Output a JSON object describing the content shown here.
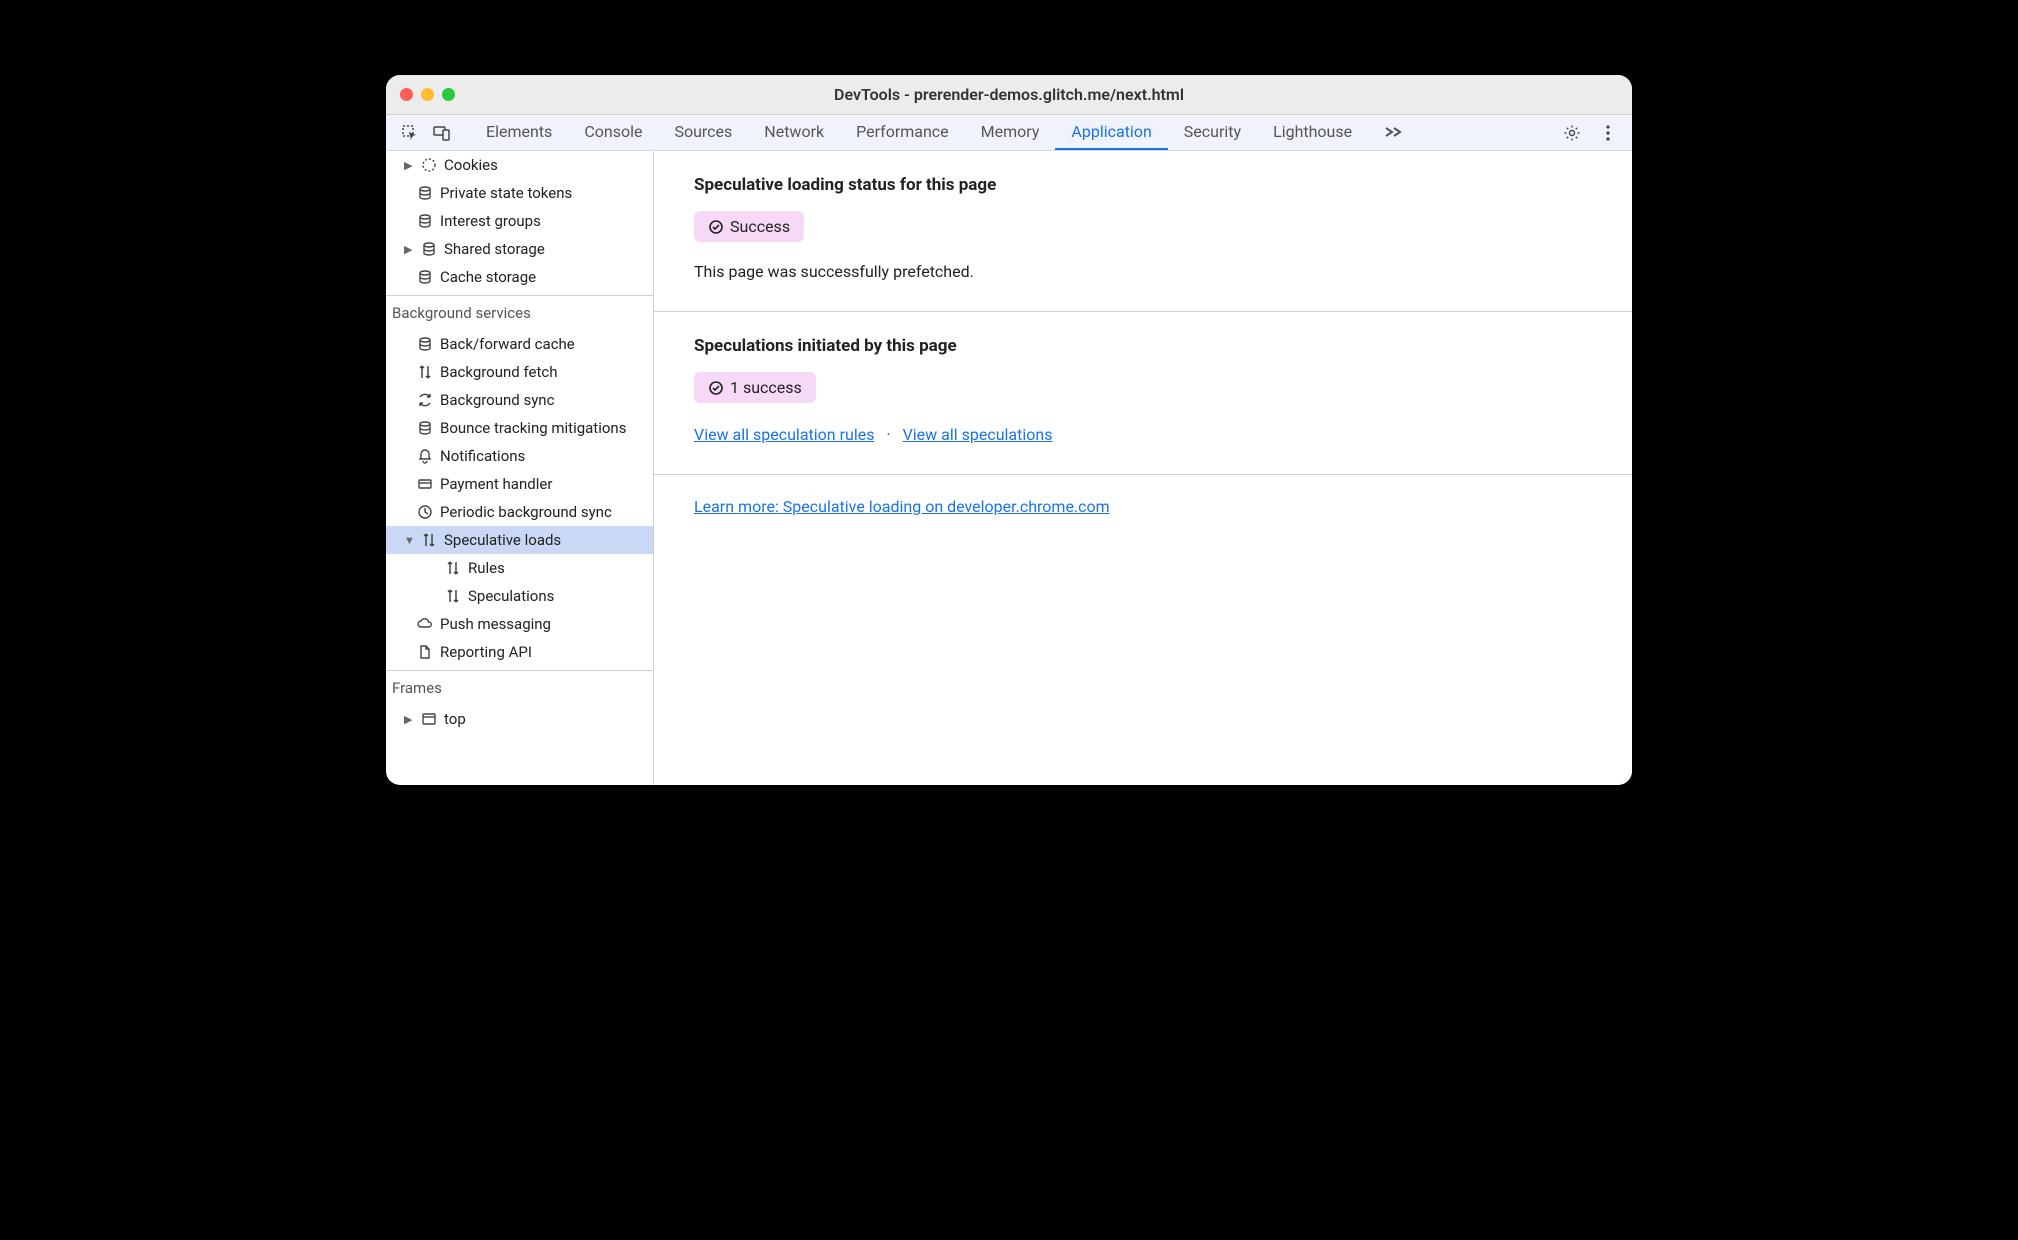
{
  "window": {
    "title": "DevTools - prerender-demos.glitch.me/next.html"
  },
  "tabs": {
    "items": [
      "Elements",
      "Console",
      "Sources",
      "Network",
      "Performance",
      "Memory",
      "Application",
      "Security",
      "Lighthouse"
    ],
    "active": "Application"
  },
  "sidebar": {
    "storage": {
      "items": [
        {
          "label": "Cookies",
          "icon": "cookie",
          "arrow": "right"
        },
        {
          "label": "Private state tokens",
          "icon": "db"
        },
        {
          "label": "Interest groups",
          "icon": "db"
        },
        {
          "label": "Shared storage",
          "icon": "db",
          "arrow": "right"
        },
        {
          "label": "Cache storage",
          "icon": "db"
        }
      ]
    },
    "bg_services": {
      "title": "Background services",
      "items": [
        {
          "label": "Back/forward cache",
          "icon": "db"
        },
        {
          "label": "Background fetch",
          "icon": "arrows"
        },
        {
          "label": "Background sync",
          "icon": "sync"
        },
        {
          "label": "Bounce tracking mitigations",
          "icon": "db"
        },
        {
          "label": "Notifications",
          "icon": "bell"
        },
        {
          "label": "Payment handler",
          "icon": "card"
        },
        {
          "label": "Periodic background sync",
          "icon": "clock"
        },
        {
          "label": "Speculative loads",
          "icon": "arrows",
          "arrow": "down",
          "selected": true
        },
        {
          "label": "Rules",
          "icon": "arrows",
          "indent": 2
        },
        {
          "label": "Speculations",
          "icon": "arrows",
          "indent": 2
        },
        {
          "label": "Push messaging",
          "icon": "cloud"
        },
        {
          "label": "Reporting API",
          "icon": "file"
        }
      ]
    },
    "frames": {
      "title": "Frames",
      "items": [
        {
          "label": "top",
          "icon": "window",
          "arrow": "right"
        }
      ]
    }
  },
  "main": {
    "status": {
      "heading": "Speculative loading status for this page",
      "badge": "Success",
      "description": "This page was successfully prefetched."
    },
    "initiated": {
      "heading": "Speculations initiated by this page",
      "badge": "1 success",
      "link_rules": "View all speculation rules",
      "link_speculations": "View all speculations"
    },
    "learn_more": "Learn more: Speculative loading on developer.chrome.com"
  }
}
